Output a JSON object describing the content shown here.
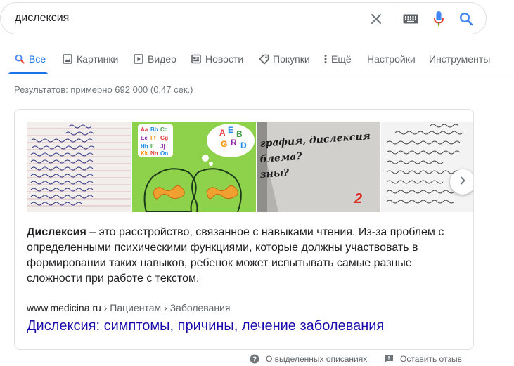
{
  "search": {
    "query": "дислексия",
    "icons": [
      "close-icon",
      "keyboard-icon",
      "microphone-icon",
      "search-icon"
    ]
  },
  "tabs": [
    {
      "label": "Все",
      "icon": "search-icon",
      "active": true
    },
    {
      "label": "Картинки",
      "icon": "image-icon"
    },
    {
      "label": "Видео",
      "icon": "video-icon"
    },
    {
      "label": "Новости",
      "icon": "news-icon"
    },
    {
      "label": "Покупки",
      "icon": "tag-icon"
    },
    {
      "label": "Ещё",
      "icon": "more-vert-icon"
    },
    {
      "label": "Настройки"
    },
    {
      "label": "Инструменты"
    }
  ],
  "stats": "Результатов: примерно 692 000 (0,47 сек.)",
  "featured": {
    "images": [
      {
        "name": "handwriting-notebook-image"
      },
      {
        "name": "brain-letters-illustration-image"
      },
      {
        "name": "disgraphia-dyslexia-slide-image",
        "lines": [
          "графия, дислексия",
          "блема?",
          "зны?"
        ],
        "number": "2"
      },
      {
        "name": "handwriting-sample-image"
      }
    ],
    "term": "Дислексия",
    "definition": " – это расстройство, связанное с навыками чтения. Из-за проблем с определенными психическими функциями, которые должны участвовать в формировании таких навыков, ребенок может испытывать самые разные сложности при работе с текстом.",
    "source_site": "www.medicina.ru",
    "source_path": " › Пациентам › Заболевания",
    "link_title": "Дислексия: симптомы, причины, лечение заболевания"
  },
  "footer": {
    "about_label": "О выделенных описаниях",
    "feedback_label": "Оставить отзыв"
  },
  "colors": {
    "accent": "#1a73e8",
    "link": "#1a0dab",
    "mic_red": "#ea4335",
    "slide_red": "#d93025",
    "brain_green_bg": "#8ed14a",
    "brain_orange": "#e8952b"
  }
}
